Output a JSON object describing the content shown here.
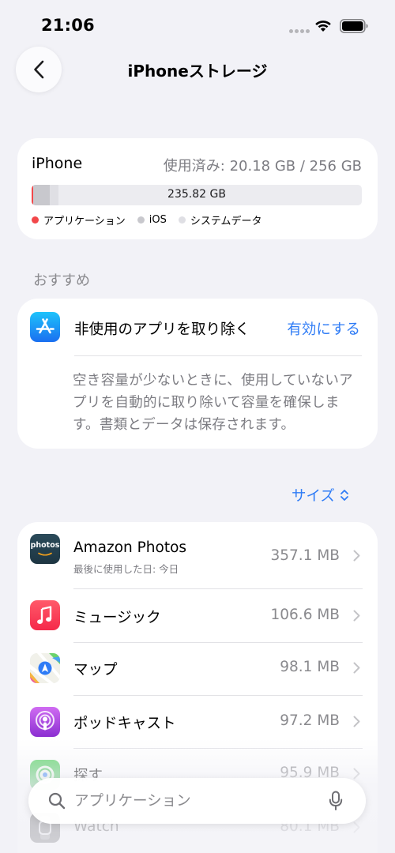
{
  "status_bar": {
    "time": "21:06"
  },
  "nav": {
    "title": "iPhoneストレージ",
    "back_icon": "chevron-left-icon"
  },
  "storage": {
    "device_name": "iPhone",
    "used_text": "使用済み: 20.18 GB / 256 GB",
    "free_text": "235.82 GB",
    "segments": [
      {
        "label": "アプリケーション",
        "color": "#f2474a",
        "fraction": 0.004
      },
      {
        "label": "iOS",
        "color": "#c8c8cd",
        "fraction": 0.05
      },
      {
        "label": "システムデータ",
        "color": "#dfdfe4",
        "fraction": 0.026
      }
    ]
  },
  "recommendations": {
    "header": "おすすめ",
    "item": {
      "icon": "app-store-icon",
      "title": "非使用のアプリを取り除く",
      "action_label": "有効にする",
      "description": "空き容量が少ないときに、使用していないアプリを自動的に取り除いて容量を確保します。書類とデータは保存されます。"
    }
  },
  "sort": {
    "label": "サイズ"
  },
  "apps": [
    {
      "name": "Amazon Photos",
      "subtitle": "最後に使用した日: 今日",
      "size": "357.1 MB",
      "icon": "amazon-photos-icon",
      "icon_text": "photos"
    },
    {
      "name": "ミュージック",
      "subtitle": "",
      "size": "106.6 MB",
      "icon": "music-icon"
    },
    {
      "name": "マップ",
      "subtitle": "",
      "size": "98.1 MB",
      "icon": "maps-icon"
    },
    {
      "name": "ポッドキャスト",
      "subtitle": "",
      "size": "97.2 MB",
      "icon": "podcasts-icon"
    },
    {
      "name": "探す",
      "subtitle": "",
      "size": "95.9 MB",
      "icon": "find-my-icon"
    },
    {
      "name": "Watch",
      "subtitle": "",
      "size": "80.1 MB",
      "icon": "watch-icon"
    }
  ],
  "search": {
    "placeholder": "アプリケーション",
    "value": ""
  },
  "colors": {
    "accent": "#2f7cf6",
    "background": "#f2f2f7"
  }
}
